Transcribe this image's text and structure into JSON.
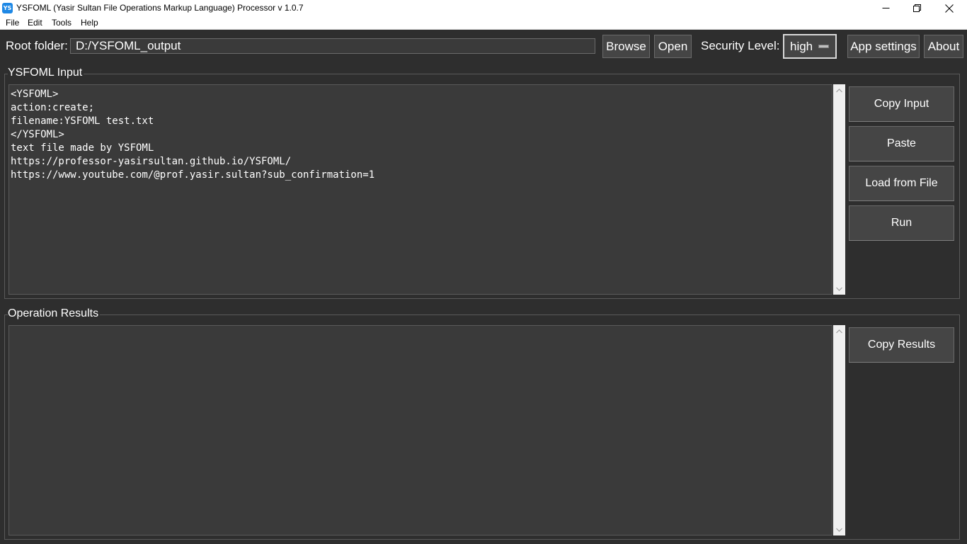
{
  "window": {
    "title": "YSFOML (Yasir Sultan File Operations Markup Language) Processor v 1.0.7",
    "icon_text": "YS",
    "controls": [
      "minimize-icon",
      "maximize-icon",
      "close-icon"
    ]
  },
  "menu": {
    "items": [
      "File",
      "Edit",
      "Tools",
      "Help"
    ]
  },
  "toolbar": {
    "root_label": "Root folder:",
    "root_value": "D:/YSFOML_output",
    "browse_label": "Browse",
    "open_label": "Open",
    "security_label": "Security Level:",
    "security_value": "high",
    "app_settings_label": "App settings",
    "about_label": "About"
  },
  "input_section": {
    "title": "YSFOML Input",
    "text": "<YSFOML>\naction:create;\nfilename:YSFOML test.txt\n</YSFOML>\ntext file made by YSFOML\nhttps://professor-yasirsultan.github.io/YSFOML/\nhttps://www.youtube.com/@prof.yasir.sultan?sub_confirmation=1",
    "buttons": {
      "copy_input": "Copy Input",
      "paste": "Paste",
      "load_from_file": "Load from File",
      "run": "Run"
    }
  },
  "results_section": {
    "title": "Operation Results",
    "text": "",
    "buttons": {
      "copy_results": "Copy Results"
    }
  },
  "colors": {
    "background": "#2e2e2e",
    "panel": "#3a3a3a",
    "button": "#454545",
    "accent": "#1e88e5"
  }
}
